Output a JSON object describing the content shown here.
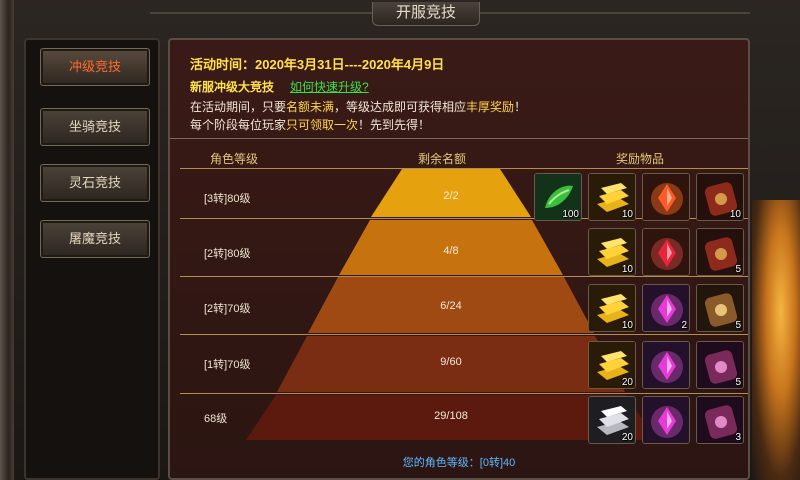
{
  "window": {
    "title": "开服竞技"
  },
  "sidebar": {
    "items": [
      {
        "label": "冲级竞技",
        "active": true
      },
      {
        "label": "坐骑竞技",
        "active": false
      },
      {
        "label": "灵石竞技",
        "active": false
      },
      {
        "label": "屠魔竞技",
        "active": false
      }
    ]
  },
  "event": {
    "time_line": "活动时间：2020年3月31日----2020年4月9日",
    "name": "新服冲级大竞技",
    "how_link": "如何快速升级?",
    "desc1_a": "在活动期间，只要",
    "desc1_hl1": "名额未满",
    "desc1_b": "，等级达成即可获得相应",
    "desc1_hl2": "丰厚奖励",
    "desc1_c": "！",
    "desc2_a": "每个阶段每位玩家",
    "desc2_hl": "只可领取一次",
    "desc2_b": "！先到先得！"
  },
  "table": {
    "headers": {
      "level": "角色等级",
      "remaining": "剩余名额",
      "rewards": "奖励物品"
    },
    "rows": [
      {
        "level": "[3转]80级",
        "remaining": "2/2",
        "rewards": [
          {
            "icon": "green-herb-icon",
            "qty": "100"
          },
          {
            "icon": "gold-bars-icon",
            "qty": "10"
          },
          {
            "icon": "red-gem-pendant-icon",
            "qty": ""
          },
          {
            "icon": "red-bracer-icon",
            "qty": "10"
          }
        ]
      },
      {
        "level": "[2转]80级",
        "remaining": "4/8",
        "rewards": [
          {
            "icon": "gold-bars-icon",
            "qty": "10"
          },
          {
            "icon": "red-gem-pendant-icon",
            "qty": ""
          },
          {
            "icon": "red-bracer-icon",
            "qty": "5"
          }
        ]
      },
      {
        "level": "[2转]70级",
        "remaining": "6/24",
        "rewards": [
          {
            "icon": "gold-bars-icon",
            "qty": "10"
          },
          {
            "icon": "purple-gem-pendant-icon",
            "qty": "2"
          },
          {
            "icon": "bronze-bracer-icon",
            "qty": "5"
          }
        ]
      },
      {
        "level": "[1转]70级",
        "remaining": "9/60",
        "rewards": [
          {
            "icon": "gold-bars-icon",
            "qty": "20"
          },
          {
            "icon": "purple-gem-pendant-icon",
            "qty": ""
          },
          {
            "icon": "purple-bracer-icon",
            "qty": "5"
          }
        ]
      },
      {
        "level": "68级",
        "remaining": "29/108",
        "rewards": [
          {
            "icon": "silver-bars-icon",
            "qty": "20"
          },
          {
            "icon": "purple-gem-pendant-icon",
            "qty": ""
          },
          {
            "icon": "purple-bracer-icon",
            "qty": "3"
          }
        ]
      }
    ]
  },
  "footer": {
    "your_level": "您的角色等级：[0转]40"
  },
  "colors": {
    "tier1": "#e6a10f",
    "tier2": "#c5720f",
    "tier3": "#9e4a12",
    "tier4": "#7a2d12",
    "tier5": "#5c1a0f",
    "title_yellow": "#ffe14a",
    "link_green": "#3ce04a",
    "level_blue": "#5fb9ff"
  }
}
